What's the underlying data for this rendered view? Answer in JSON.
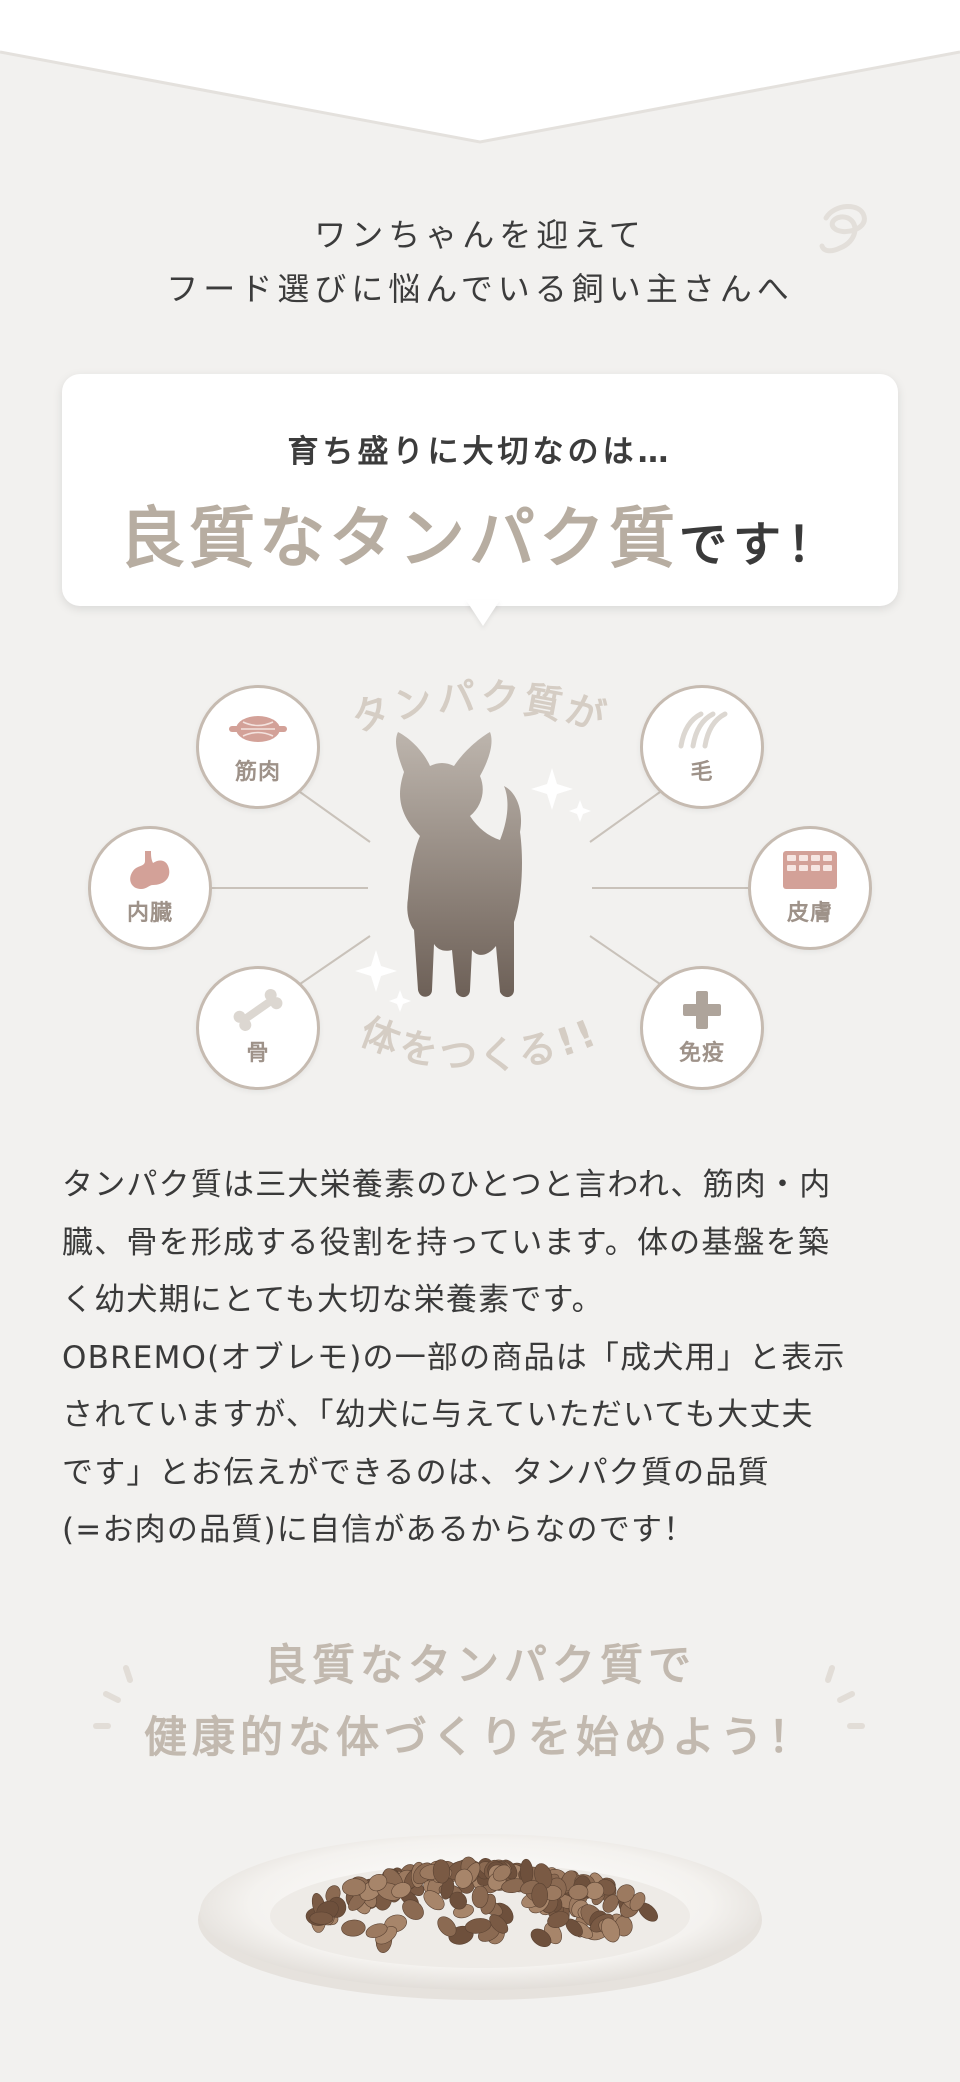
{
  "intro": {
    "line1": "ワンちゃんを迎えて",
    "line2": "フード選びに悩んでいる飼い主さんへ"
  },
  "bubble": {
    "sub": "育ち盛りに大切なのは…",
    "highlight": "良質なタンパク質",
    "tail": "です！"
  },
  "diagram": {
    "arc_top": "タンパク質が",
    "arc_bottom": "体をつくる!!",
    "nodes": {
      "muscle": {
        "label": "筋肉",
        "icon": "muscle-icon"
      },
      "hair": {
        "label": "毛",
        "icon": "hair-icon"
      },
      "organs": {
        "label": "内臓",
        "icon": "stomach-icon"
      },
      "skin": {
        "label": "皮膚",
        "icon": "skin-icon"
      },
      "bone": {
        "label": "骨",
        "icon": "bone-icon"
      },
      "immunity": {
        "label": "免疫",
        "icon": "cross-icon"
      }
    }
  },
  "body": {
    "line1": "タンパク質は三大栄養素のひとつと言われ、筋肉・内",
    "line2": "臓、骨を形成する役割を持っています。体の基盤を築",
    "line3": "く幼犬期にとても大切な栄養素です。",
    "line4": "OBREMO(オブレモ)の一部の商品は「成犬用」と表示",
    "line5": "されていますが、「幼犬に与えていただいても大丈夫",
    "line6": "です」とお伝えができるのは、タンパク質の品質",
    "line7": "(=お肉の品質)に自信があるからなのです！"
  },
  "closing": {
    "line1": "良質なタンパク質で",
    "line2": "健康的な体づくりを始めよう！"
  },
  "colors": {
    "background": "#f2f1ef",
    "accent_beige": "#b7ada1",
    "icon_pink": "#d3a198",
    "node_border": "#c6bbb1",
    "text": "#3a3a3a"
  }
}
